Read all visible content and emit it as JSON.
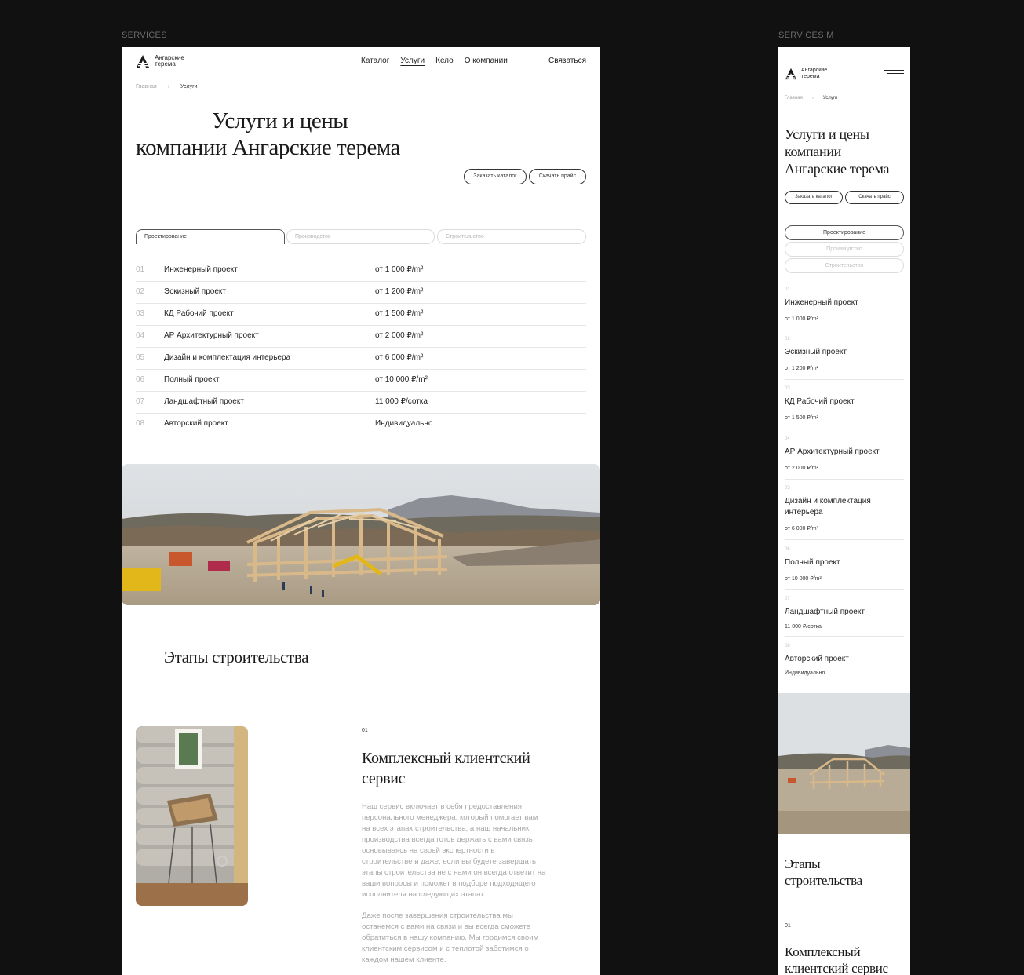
{
  "frames": {
    "desktop_label": "SERVICES",
    "mobile_label": "SERVICES M"
  },
  "brand": {
    "line1": "Ангарские",
    "line2": "терема"
  },
  "nav": {
    "items": [
      "Каталог",
      "Услуги",
      "Кело",
      "О компании"
    ],
    "active": "Услуги",
    "contact": "Связаться"
  },
  "breadcrumbs": {
    "home": "Главная",
    "current": "Услуги"
  },
  "hero": {
    "title_line1": "Услуги и цены",
    "title_line2": "компании Ангарские терема",
    "mobile_title": [
      "Услуги и цены",
      "компании",
      "Ангарские терема"
    ],
    "order_catalog": "Заказать каталог",
    "download_price": "Скачать прайс"
  },
  "tabs": [
    "Проектирование",
    "Производство",
    "Строительство"
  ],
  "services": [
    {
      "num": "01",
      "name": "Инженерный проект",
      "price": "от 1 000 ₽/m²"
    },
    {
      "num": "02",
      "name": "Эскизный проект",
      "price": "от 1 200 ₽/m²"
    },
    {
      "num": "03",
      "name": "КД Рабочий проект",
      "price": "от 1 500 ₽/m²"
    },
    {
      "num": "04",
      "name": "АР Архитектурный проект",
      "price": "от 2 000 ₽/m²"
    },
    {
      "num": "05",
      "name": "Дизайн и комплектация интерьера",
      "price": "от 6 000 ₽/m²"
    },
    {
      "num": "06",
      "name": "Полный проект",
      "price": "от 10 000 ₽/m²"
    },
    {
      "num": "07",
      "name": "Ландшафтный проект",
      "price": "11 000 ₽/сотка"
    },
    {
      "num": "08",
      "name": "Авторский проект",
      "price": "Индивидуально"
    }
  ],
  "mobile_service_names": [
    "Инженерный проект",
    "Эскизный проект",
    "КД Рабочий проект",
    "АР Архитектурный проект",
    "Дизайн и комплектация",
    "интерьера",
    "Полный проект",
    "Ландшафтный проект",
    "Авторский проект"
  ],
  "stages": {
    "title": "Этапы строительства",
    "mobile_title": [
      "Этапы",
      "строительства"
    ],
    "step_num": "01",
    "step_title_line1": "Комплексный клиентский",
    "step_title_line2": "сервис",
    "mobile_step_title": [
      "Комплексный",
      "клиентский сервис"
    ],
    "paragraph1": [
      "Наш сервис включает в себя предоставления",
      "персонального менеджера, который помогает вам",
      "на всех этапах строительства, а наш начальник",
      "производства всегда готов держать с вами связь",
      "основываясь на своей экспертности в",
      "строительстве и даже, если вы будете завершать",
      "этапы строительства не с нами он всегда ответит на",
      "ваши вопросы и поможет в подборе подходящего",
      "исполнителя на следующих этапах."
    ],
    "paragraph2": [
      "Даже после завершения строительства мы",
      "останемся с вами на связи и вы всегда сможете",
      "обратиться в нашу компанию. Мы гордимся своим",
      "клиентским сервисом и с теплотой заботимся о",
      "каждом нашем клиенте."
    ]
  },
  "colors": {
    "page_bg": "#111111",
    "frame_bg": "#ffffff",
    "text": "#1a1a1a",
    "muted": "#a8a8a8",
    "wood": "#d9b98a"
  }
}
